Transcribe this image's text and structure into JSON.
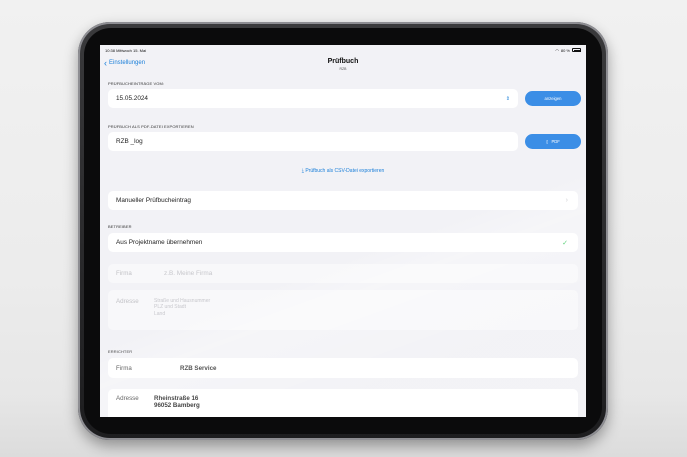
{
  "statusbar": {
    "time": "10:38 Mittwoch 15. Mai",
    "battery": "80 %"
  },
  "nav": {
    "back_label": "Einstellungen",
    "title": "Prüfbuch",
    "subtitle": "RZB"
  },
  "entries": {
    "section_label": "PRÜFBUCHEINTRÄGE VOM:",
    "date_value": "15.05.2024",
    "show_button": "anzeigen"
  },
  "pdf": {
    "section_label": "PRÜFBUCH ALS PDF-DATEI EXPORTIEREN",
    "filename_value": "RZB _log",
    "pdf_button": "PDF"
  },
  "csv_link": "Prüfbuch als CSV-Datei exportieren",
  "manual_entry": "Manueller Prüfbucheintrag",
  "betreiber": {
    "section_label": "BETREIBER",
    "from_project": "Aus Projektname übernehmen",
    "firma_label": "Firma",
    "firma_placeholder": "z.B. Meine Firma",
    "adresse_label": "Adresse",
    "adresse_placeholder": [
      "Straße und Hausnummer",
      "PLZ und Stadt",
      "Land"
    ]
  },
  "errichter": {
    "section_label": "ERRICHTER",
    "firma_label": "Firma",
    "firma_value": "RZB Service",
    "adresse_label": "Adresse",
    "adresse_lines": [
      "Rheinstraße 16",
      "96052 Bamberg"
    ]
  },
  "colors": {
    "accent": "#1a7fd9",
    "button": "#3b8ee6",
    "check": "#34c759",
    "background": "#f2f2f6"
  }
}
